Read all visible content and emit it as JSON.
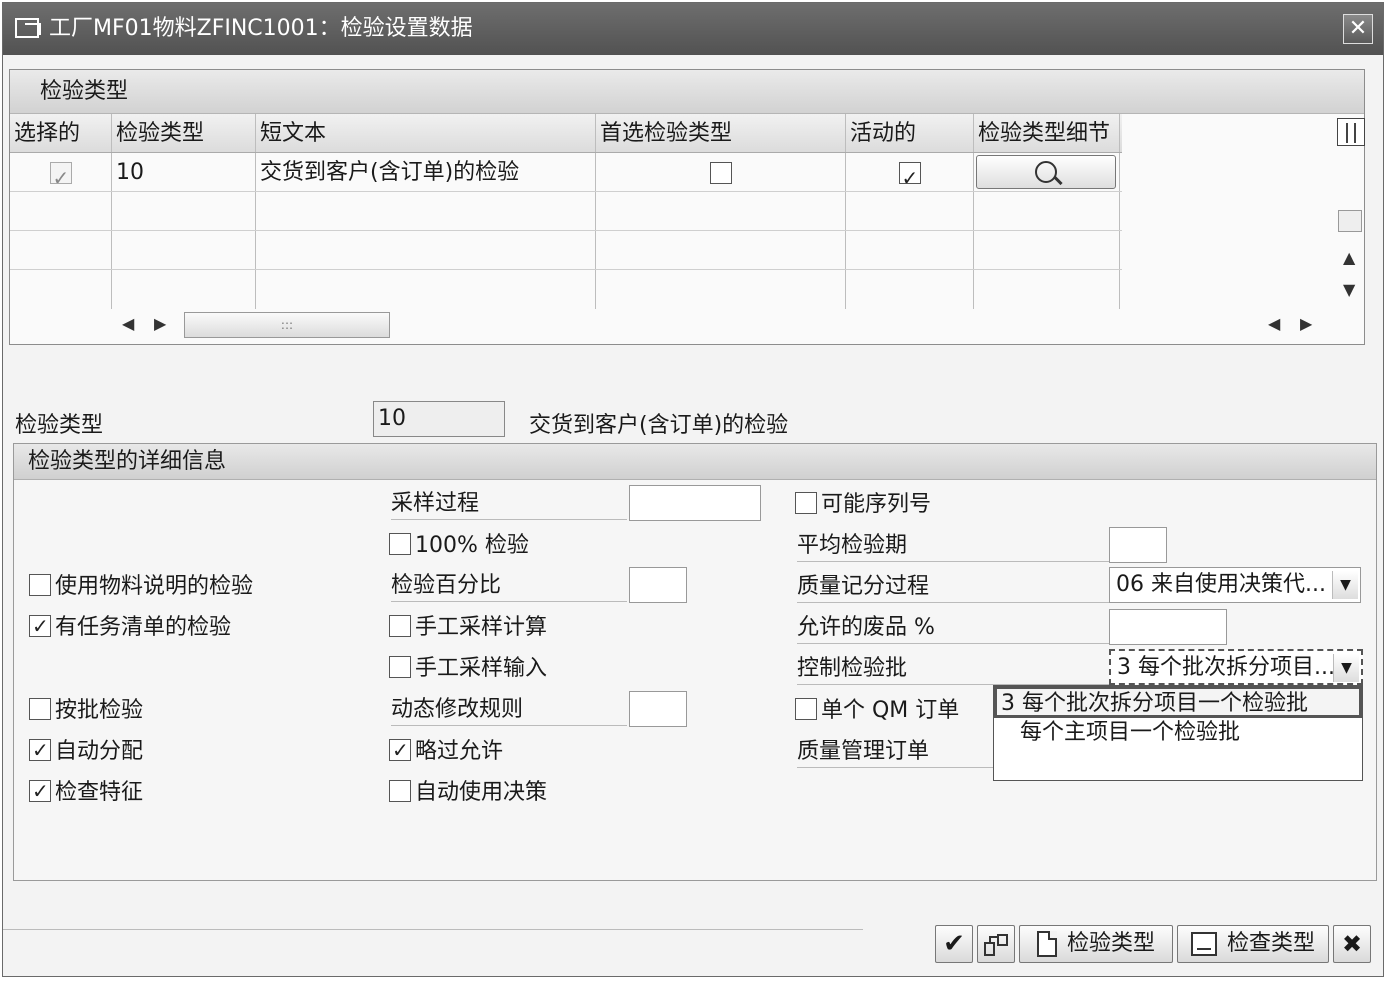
{
  "window": {
    "title": "工厂MF01物料ZFINC1001：检验设置数据",
    "close_glyph": "✕"
  },
  "table": {
    "section_title": "检验类型",
    "columns": [
      "选择的",
      "检验类型",
      "短文本",
      "首选检验类型",
      "活动的",
      "检验类型细节"
    ],
    "rows": [
      {
        "selected": true,
        "type": "10",
        "short_text": "交货到客户(含订单)的检验",
        "preferred": false,
        "active": true,
        "has_detail": true
      }
    ],
    "empty_rows": 3
  },
  "selected_type": {
    "label": "检验类型",
    "value": "10",
    "description": "交货到客户(含订单)的检验"
  },
  "details": {
    "title": "检验类型的详细信息",
    "col1": [
      {
        "label": "使用物料说明的检验",
        "checked": false
      },
      {
        "label": "有任务清单的检验",
        "checked": true
      },
      {
        "label": "按批检验",
        "checked": false
      },
      {
        "label": "自动分配",
        "checked": true
      },
      {
        "label": "检查特征",
        "checked": true
      }
    ],
    "sampling_procedure_label": "采样过程",
    "pct100_label": "100% 检验",
    "pct100_checked": false,
    "inspection_percent_label": "检验百分比",
    "manual_sample_calc_label": "手工采样计算",
    "manual_sample_calc_checked": false,
    "manual_sample_entry_label": "手工采样输入",
    "manual_sample_entry_checked": false,
    "dynamic_mod_rule_label": "动态修改规则",
    "skip_allowed_label": "略过允许",
    "skip_allowed_checked": true,
    "auto_ud_label": "自动使用决策",
    "auto_ud_checked": false,
    "serial_possible_label": "可能序列号",
    "serial_possible_checked": false,
    "avg_insp_duration_label": "平均检验期",
    "quality_score_label": "质量记分过程",
    "quality_score_value": "06 来自使用决策代...",
    "allowed_scrap_label": "允许的废品 %",
    "control_lot_label": "控制检验批",
    "control_lot_value": "3 每个批次拆分项目...",
    "single_qm_order_label": "单个 QM 订单",
    "single_qm_order_checked": false,
    "qm_order_label": "质量管理订单"
  },
  "dropdown_list": {
    "options": [
      "3 每个批次拆分项目一个检验批",
      "每个主项目一个检验批"
    ],
    "selected_index": 0
  },
  "footer": {
    "confirm_glyph": "✔",
    "button_inspection_type": "检验类型",
    "button_check_type": "检查类型",
    "cancel_glyph": "✖"
  }
}
